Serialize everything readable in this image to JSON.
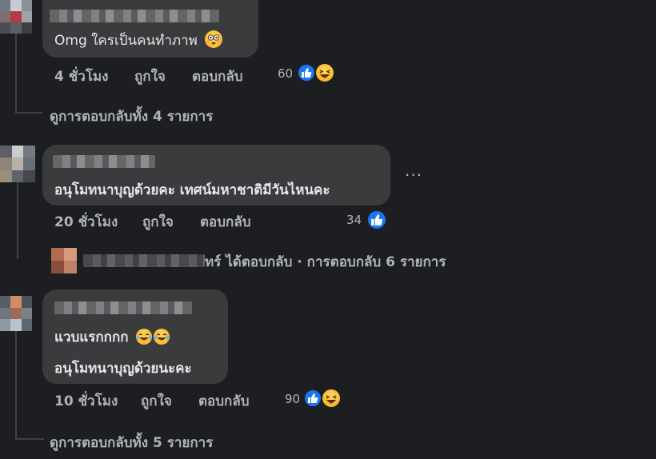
{
  "comments": [
    {
      "text": "Omg ใครเป็นคนทำภาพ",
      "emoji": "flushed-face",
      "time": "4 ชั่วโมง",
      "like_label": "ถูกใจ",
      "reply_label": "ตอบกลับ",
      "reaction_count": "60",
      "reactions": [
        "like",
        "haha"
      ],
      "view_replies": "ดูการตอบกลับทั้ง 4 รายการ"
    },
    {
      "text": "อนุโมทนาบุญด้วยคะ เทศน์มหาชาติมีวันไหนคะ",
      "time": "20 ชั่วโมง",
      "like_label": "ถูกใจ",
      "reply_label": "ตอบกลับ",
      "reaction_count": "34",
      "reactions": [
        "like"
      ],
      "reply_summary": "ทร์ ได้ตอบกลับ · การตอบกลับ 6 รายการ"
    },
    {
      "text_line1": "แวบแรกกกก",
      "text_line1_emojis": [
        "tears-of-joy",
        "tears-of-joy"
      ],
      "text_line2": "อนุโมทนาบุญด้วยนะคะ",
      "time": "10 ชั่วโมง",
      "like_label": "ถูกใจ",
      "reply_label": "ตอบกลับ",
      "reaction_count": "90",
      "reactions": [
        "like",
        "haha"
      ],
      "view_replies": "ดูการตอบกลับทั้ง 5 รายการ"
    }
  ],
  "more_options": "···",
  "colors": {
    "background": "#1c1e21",
    "bubble": "#3a3b3c",
    "text": "#e4e6eb",
    "secondary": "#b0b3b8",
    "like_blue": "#1877f2",
    "haha_yellow": "#f7b928"
  }
}
